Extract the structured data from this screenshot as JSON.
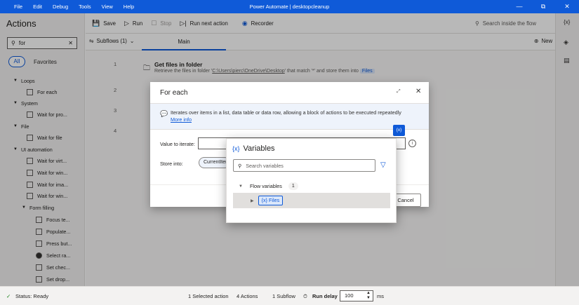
{
  "titlebar": {
    "menu": [
      "File",
      "Edit",
      "Debug",
      "Tools",
      "View",
      "Help"
    ],
    "title": "Power Automate | desktopcleanup",
    "controls": [
      "—",
      "⧉",
      "✕"
    ]
  },
  "actions_pane": {
    "title": "Actions",
    "search_value": "for",
    "filter_all": "All",
    "filter_favorites": "Favorites",
    "tree": [
      {
        "label": "Loops",
        "type": "cat"
      },
      {
        "label": "For each",
        "type": "item"
      },
      {
        "label": "System",
        "type": "cat"
      },
      {
        "label": "Wait for pro...",
        "type": "item"
      },
      {
        "label": "File",
        "type": "cat"
      },
      {
        "label": "Wait for file",
        "type": "item"
      },
      {
        "label": "UI automation",
        "type": "cat"
      },
      {
        "label": "Wait for virt...",
        "type": "item"
      },
      {
        "label": "Wait for win...",
        "type": "item"
      },
      {
        "label": "Wait for ima...",
        "type": "item"
      },
      {
        "label": "Wait for win...",
        "type": "item"
      },
      {
        "label": "Form filling",
        "type": "sub"
      },
      {
        "label": "Focus te...",
        "type": "item2"
      },
      {
        "label": "Populate...",
        "type": "item2"
      },
      {
        "label": "Press but...",
        "type": "item2"
      },
      {
        "label": "Select ra...",
        "type": "item2"
      },
      {
        "label": "Set chec...",
        "type": "item2"
      },
      {
        "label": "Set drop...",
        "type": "item2"
      }
    ]
  },
  "toolbar": {
    "save": "Save",
    "run": "Run",
    "stop": "Stop",
    "run_next": "Run next action",
    "recorder": "Recorder",
    "search": "Search inside the flow"
  },
  "subbar": {
    "subflows": "Subflows (1)",
    "main_tab": "Main",
    "new": "New"
  },
  "flow": {
    "steps": [
      {
        "num": "1",
        "title": "Get files in folder",
        "desc_pre": "Retrieve the files in folder '",
        "desc_path": "C:\\Users\\pierc\\OneDrive\\Desktop",
        "desc_mid": "' that match '*' and store them into ",
        "desc_var": "Files"
      },
      {
        "num": "2"
      },
      {
        "num": "3"
      },
      {
        "num": "4"
      }
    ]
  },
  "dialog": {
    "title": "For each",
    "info_text": "Iterates over items in a list, data table or data row, allowing a block of actions to be executed repeatedly",
    "more_info": "More info",
    "var_button": "{x}",
    "value_label": "Value to iterate:",
    "store_label": "Store into:",
    "store_chip": "CurrentItem",
    "cancel": "Cancel"
  },
  "variables_panel": {
    "title": "Variables",
    "title_icon": "{x}",
    "search_placeholder": "Search variables",
    "group_label": "Flow variables",
    "group_count": "1",
    "var_icon": "{x}",
    "var_name": "Files"
  },
  "statusbar": {
    "status": "Status: Ready",
    "selected": "1 Selected action",
    "actions": "4 Actions",
    "subflow": "1 Subflow",
    "run_delay_label": "Run delay",
    "run_delay_value": "100",
    "unit": "ms"
  }
}
